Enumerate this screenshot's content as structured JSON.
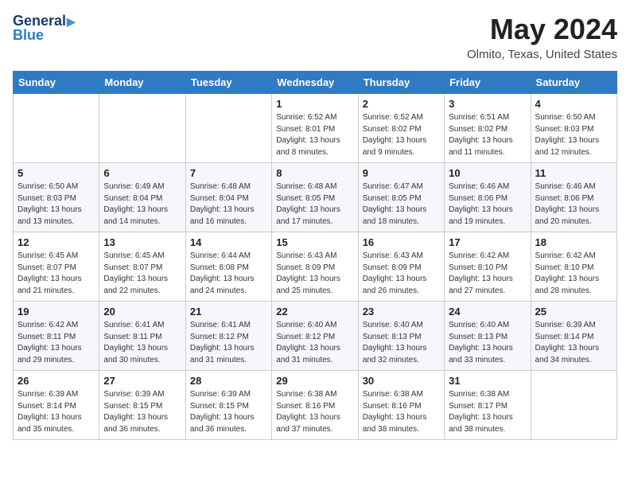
{
  "header": {
    "logo_line1": "General",
    "logo_line2": "Blue",
    "month_year": "May 2024",
    "location": "Olmito, Texas, United States"
  },
  "weekdays": [
    "Sunday",
    "Monday",
    "Tuesday",
    "Wednesday",
    "Thursday",
    "Friday",
    "Saturday"
  ],
  "weeks": [
    [
      {
        "day": "",
        "info": ""
      },
      {
        "day": "",
        "info": ""
      },
      {
        "day": "",
        "info": ""
      },
      {
        "day": "1",
        "info": "Sunrise: 6:52 AM\nSunset: 8:01 PM\nDaylight: 13 hours and 8 minutes."
      },
      {
        "day": "2",
        "info": "Sunrise: 6:52 AM\nSunset: 8:02 PM\nDaylight: 13 hours and 9 minutes."
      },
      {
        "day": "3",
        "info": "Sunrise: 6:51 AM\nSunset: 8:02 PM\nDaylight: 13 hours and 11 minutes."
      },
      {
        "day": "4",
        "info": "Sunrise: 6:50 AM\nSunset: 8:03 PM\nDaylight: 13 hours and 12 minutes."
      }
    ],
    [
      {
        "day": "5",
        "info": "Sunrise: 6:50 AM\nSunset: 8:03 PM\nDaylight: 13 hours and 13 minutes."
      },
      {
        "day": "6",
        "info": "Sunrise: 6:49 AM\nSunset: 8:04 PM\nDaylight: 13 hours and 14 minutes."
      },
      {
        "day": "7",
        "info": "Sunrise: 6:48 AM\nSunset: 8:04 PM\nDaylight: 13 hours and 16 minutes."
      },
      {
        "day": "8",
        "info": "Sunrise: 6:48 AM\nSunset: 8:05 PM\nDaylight: 13 hours and 17 minutes."
      },
      {
        "day": "9",
        "info": "Sunrise: 6:47 AM\nSunset: 8:05 PM\nDaylight: 13 hours and 18 minutes."
      },
      {
        "day": "10",
        "info": "Sunrise: 6:46 AM\nSunset: 8:06 PM\nDaylight: 13 hours and 19 minutes."
      },
      {
        "day": "11",
        "info": "Sunrise: 6:46 AM\nSunset: 8:06 PM\nDaylight: 13 hours and 20 minutes."
      }
    ],
    [
      {
        "day": "12",
        "info": "Sunrise: 6:45 AM\nSunset: 8:07 PM\nDaylight: 13 hours and 21 minutes."
      },
      {
        "day": "13",
        "info": "Sunrise: 6:45 AM\nSunset: 8:07 PM\nDaylight: 13 hours and 22 minutes."
      },
      {
        "day": "14",
        "info": "Sunrise: 6:44 AM\nSunset: 8:08 PM\nDaylight: 13 hours and 24 minutes."
      },
      {
        "day": "15",
        "info": "Sunrise: 6:43 AM\nSunset: 8:09 PM\nDaylight: 13 hours and 25 minutes."
      },
      {
        "day": "16",
        "info": "Sunrise: 6:43 AM\nSunset: 8:09 PM\nDaylight: 13 hours and 26 minutes."
      },
      {
        "day": "17",
        "info": "Sunrise: 6:42 AM\nSunset: 8:10 PM\nDaylight: 13 hours and 27 minutes."
      },
      {
        "day": "18",
        "info": "Sunrise: 6:42 AM\nSunset: 8:10 PM\nDaylight: 13 hours and 28 minutes."
      }
    ],
    [
      {
        "day": "19",
        "info": "Sunrise: 6:42 AM\nSunset: 8:11 PM\nDaylight: 13 hours and 29 minutes."
      },
      {
        "day": "20",
        "info": "Sunrise: 6:41 AM\nSunset: 8:11 PM\nDaylight: 13 hours and 30 minutes."
      },
      {
        "day": "21",
        "info": "Sunrise: 6:41 AM\nSunset: 8:12 PM\nDaylight: 13 hours and 31 minutes."
      },
      {
        "day": "22",
        "info": "Sunrise: 6:40 AM\nSunset: 8:12 PM\nDaylight: 13 hours and 31 minutes."
      },
      {
        "day": "23",
        "info": "Sunrise: 6:40 AM\nSunset: 8:13 PM\nDaylight: 13 hours and 32 minutes."
      },
      {
        "day": "24",
        "info": "Sunrise: 6:40 AM\nSunset: 8:13 PM\nDaylight: 13 hours and 33 minutes."
      },
      {
        "day": "25",
        "info": "Sunrise: 6:39 AM\nSunset: 8:14 PM\nDaylight: 13 hours and 34 minutes."
      }
    ],
    [
      {
        "day": "26",
        "info": "Sunrise: 6:39 AM\nSunset: 8:14 PM\nDaylight: 13 hours and 35 minutes."
      },
      {
        "day": "27",
        "info": "Sunrise: 6:39 AM\nSunset: 8:15 PM\nDaylight: 13 hours and 36 minutes."
      },
      {
        "day": "28",
        "info": "Sunrise: 6:39 AM\nSunset: 8:15 PM\nDaylight: 13 hours and 36 minutes."
      },
      {
        "day": "29",
        "info": "Sunrise: 6:38 AM\nSunset: 8:16 PM\nDaylight: 13 hours and 37 minutes."
      },
      {
        "day": "30",
        "info": "Sunrise: 6:38 AM\nSunset: 8:16 PM\nDaylight: 13 hours and 38 minutes."
      },
      {
        "day": "31",
        "info": "Sunrise: 6:38 AM\nSunset: 8:17 PM\nDaylight: 13 hours and 38 minutes."
      },
      {
        "day": "",
        "info": ""
      }
    ]
  ]
}
